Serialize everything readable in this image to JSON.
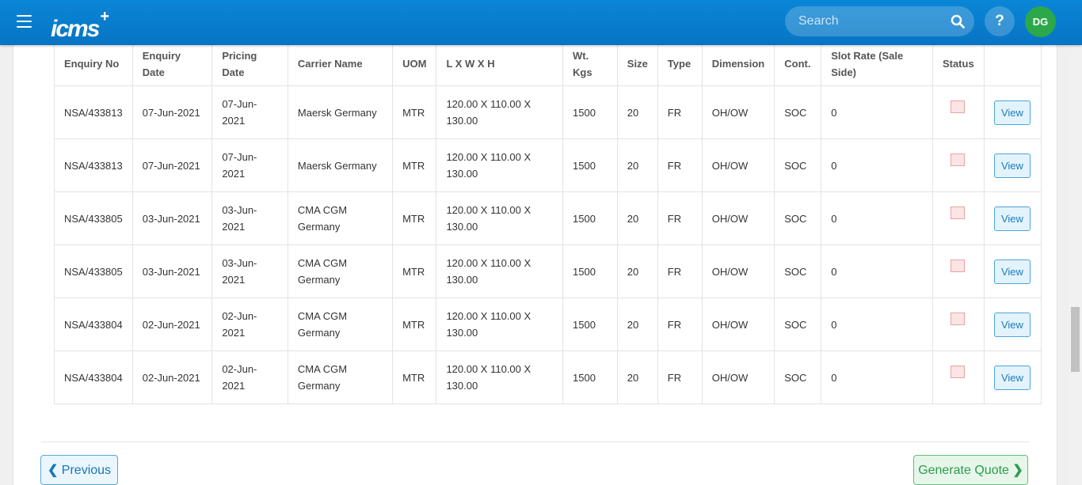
{
  "header": {
    "logo_text": "icms",
    "logo_plus": "+",
    "search_placeholder": "Search",
    "help_label": "?",
    "avatar_initials": "DG"
  },
  "table": {
    "columns": [
      "Enquiry No",
      "Enquiry Date",
      "Pricing Date",
      "Carrier Name",
      "UOM",
      "L X W X H",
      "Wt. Kgs",
      "Size",
      "Type",
      "Dimension",
      "Cont.",
      "Slot Rate (Sale Side)",
      "Status",
      ""
    ],
    "rows": [
      {
        "enquiry_no": "NSA/433813",
        "enquiry_date": "07-Jun-2021",
        "pricing_date": "07-Jun-2021",
        "carrier": "Maersk Germany",
        "uom": "MTR",
        "dims": "120.00 X 110.00 X 130.00",
        "wt": "1500",
        "size": "20",
        "type": "FR",
        "dimension": "OH/OW",
        "cont": "SOC",
        "slot_rate": "0",
        "action": "View"
      },
      {
        "enquiry_no": "NSA/433813",
        "enquiry_date": "07-Jun-2021",
        "pricing_date": "07-Jun-2021",
        "carrier": "Maersk Germany",
        "uom": "MTR",
        "dims": "120.00 X 110.00 X 130.00",
        "wt": "1500",
        "size": "20",
        "type": "FR",
        "dimension": "OH/OW",
        "cont": "SOC",
        "slot_rate": "0",
        "action": "View"
      },
      {
        "enquiry_no": "NSA/433805",
        "enquiry_date": "03-Jun-2021",
        "pricing_date": "03-Jun-2021",
        "carrier": "CMA CGM Germany",
        "uom": "MTR",
        "dims": "120.00 X 110.00 X 130.00",
        "wt": "1500",
        "size": "20",
        "type": "FR",
        "dimension": "OH/OW",
        "cont": "SOC",
        "slot_rate": "0",
        "action": "View"
      },
      {
        "enquiry_no": "NSA/433805",
        "enquiry_date": "03-Jun-2021",
        "pricing_date": "03-Jun-2021",
        "carrier": "CMA CGM Germany",
        "uom": "MTR",
        "dims": "120.00 X 110.00 X 130.00",
        "wt": "1500",
        "size": "20",
        "type": "FR",
        "dimension": "OH/OW",
        "cont": "SOC",
        "slot_rate": "0",
        "action": "View"
      },
      {
        "enquiry_no": "NSA/433804",
        "enquiry_date": "02-Jun-2021",
        "pricing_date": "02-Jun-2021",
        "carrier": "CMA CGM Germany",
        "uom": "MTR",
        "dims": "120.00 X 110.00 X 130.00",
        "wt": "1500",
        "size": "20",
        "type": "FR",
        "dimension": "OH/OW",
        "cont": "SOC",
        "slot_rate": "0",
        "action": "View"
      },
      {
        "enquiry_no": "NSA/433804",
        "enquiry_date": "02-Jun-2021",
        "pricing_date": "02-Jun-2021",
        "carrier": "CMA CGM Germany",
        "uom": "MTR",
        "dims": "120.00 X 110.00 X 130.00",
        "wt": "1500",
        "size": "20",
        "type": "FR",
        "dimension": "OH/OW",
        "cont": "SOC",
        "slot_rate": "0",
        "action": "View"
      }
    ]
  },
  "footer": {
    "previous_label": "Previous",
    "generate_label": "Generate Quote"
  },
  "colors": {
    "header_blue": "#0a86d6",
    "avatar_green": "#2ca84a",
    "view_blue": "#1a7bbf",
    "generate_green": "#2e9b4c",
    "status_pink": "#fbe4e4"
  }
}
